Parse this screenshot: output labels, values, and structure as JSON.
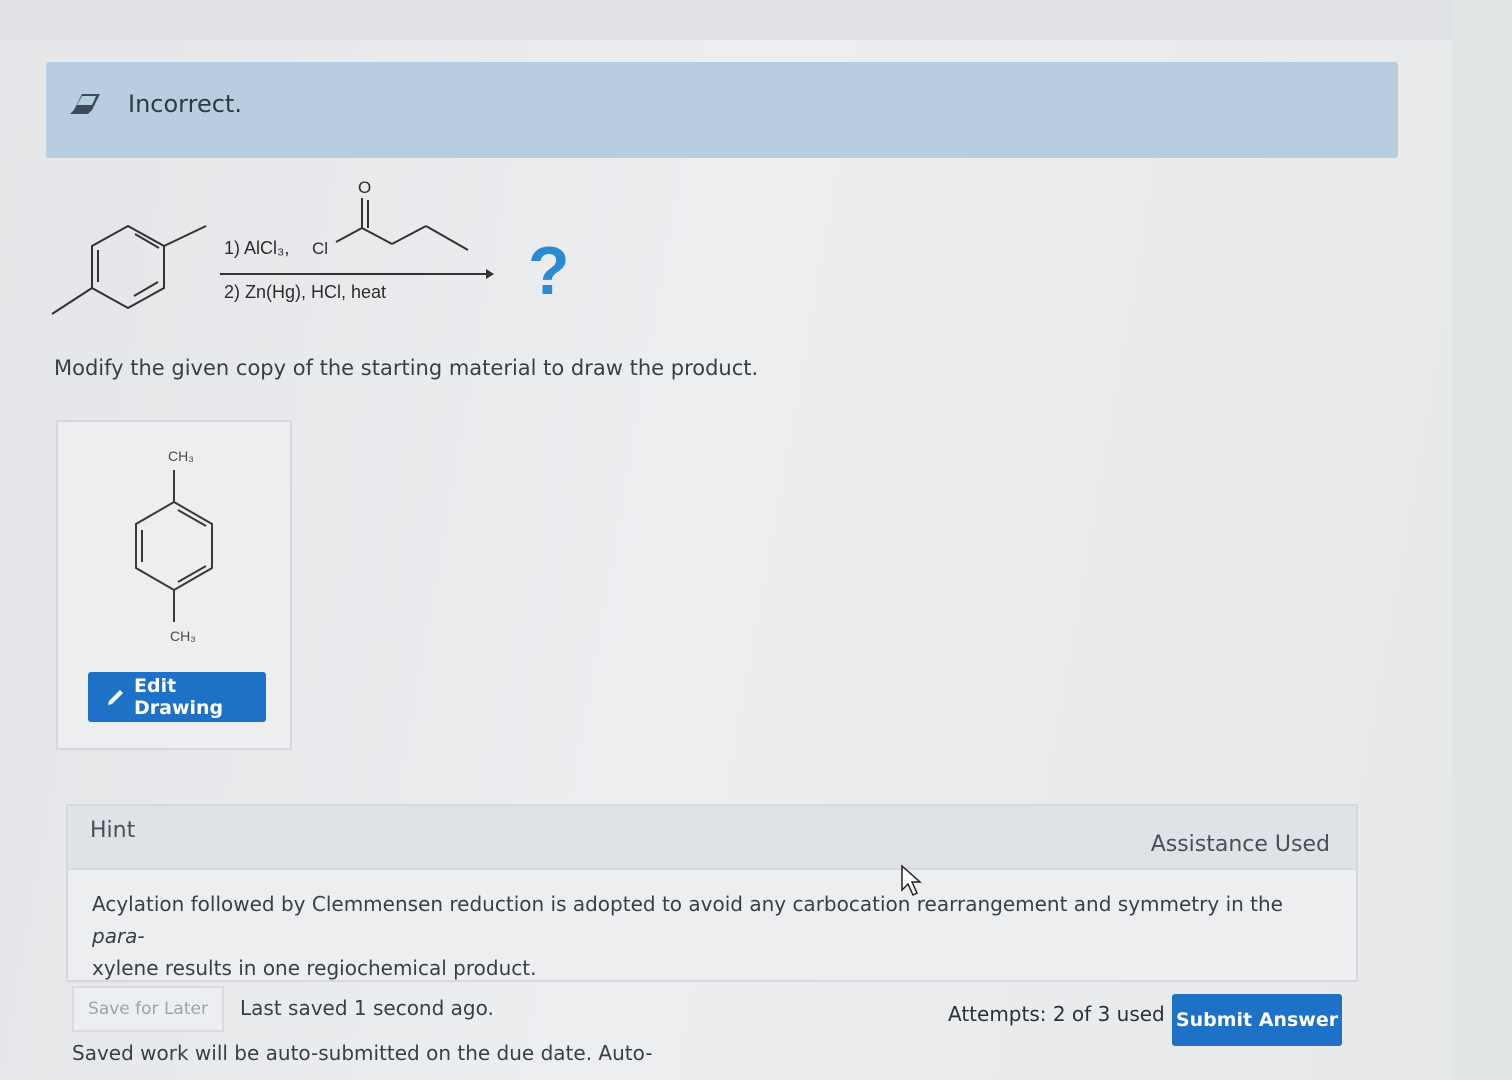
{
  "feedback": {
    "status_text": "Incorrect.",
    "icon": "eraser-icon"
  },
  "reaction": {
    "reagent_line1": "1) AlCl₃,",
    "reagent_cl": "Cl",
    "reagent_o": "O",
    "reagent_line2": "2) Zn(Hg), HCl, heat",
    "product_placeholder": "?"
  },
  "prompt": "Modify the given copy of the starting material to draw the product.",
  "drawing": {
    "top_label": "CH₃",
    "bottom_label": "CH₃",
    "edit_button_label": "Edit Drawing"
  },
  "hint": {
    "title": "Hint",
    "assistance_label": "Assistance Used",
    "body_before": "Acylation followed by Clemmensen reduction is adopted to avoid any carbocation rearrangement and symmetry in the ",
    "body_italic": "para-",
    "body_after": "xylene results in one regiochemical product."
  },
  "footer": {
    "save_button_label": "Save for Later",
    "last_saved": "Last saved 1 second ago.",
    "auto_submit_note": "Saved work will be auto-submitted on the due date. Auto-",
    "attempts": "Attempts: 2 of 3 used",
    "submit_button_label": "Submit Answer"
  },
  "colors": {
    "banner_bg": "#b9cde0",
    "primary_button": "#1d72c8",
    "question_mark": "#2a8ad4"
  }
}
